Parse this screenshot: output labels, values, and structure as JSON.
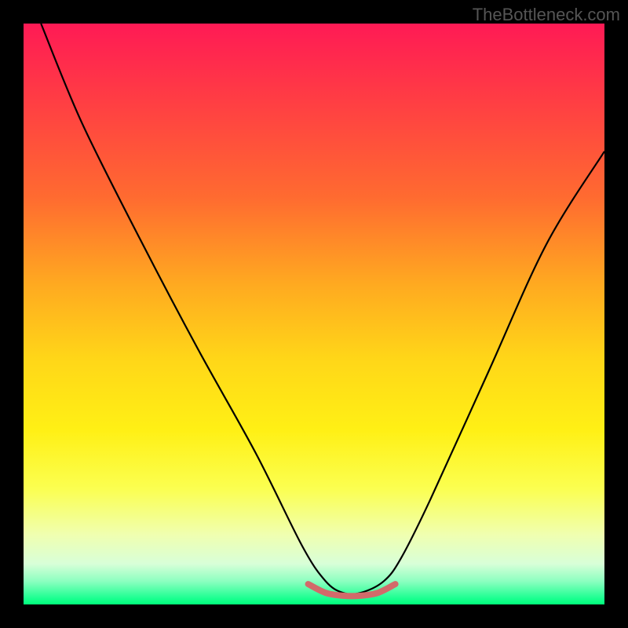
{
  "watermark": "TheBottleneck.com",
  "chart_data": {
    "type": "line",
    "title": "",
    "xlabel": "",
    "ylabel": "",
    "xlim": [
      0,
      100
    ],
    "ylim": [
      0,
      100
    ],
    "grid": false,
    "axes_visible": false,
    "background_gradient": [
      "#ff1a55",
      "#ff6b30",
      "#ffd718",
      "#fbff50",
      "#1aff90"
    ],
    "series": [
      {
        "name": "bottleneck-curve",
        "stroke": "#000000",
        "x": [
          3,
          10,
          20,
          30,
          40,
          48,
          52,
          55,
          58,
          62,
          65,
          70,
          80,
          90,
          100
        ],
        "values": [
          100,
          83,
          63,
          44,
          26,
          10,
          4,
          2,
          2,
          4,
          8,
          18,
          40,
          62,
          78
        ]
      },
      {
        "name": "optimal-zone",
        "stroke": "#d26a6a",
        "x": [
          49,
          52,
          55,
          58,
          61,
          64
        ],
        "values": [
          3.5,
          2,
          1.5,
          1.5,
          2,
          3.5
        ]
      }
    ]
  }
}
